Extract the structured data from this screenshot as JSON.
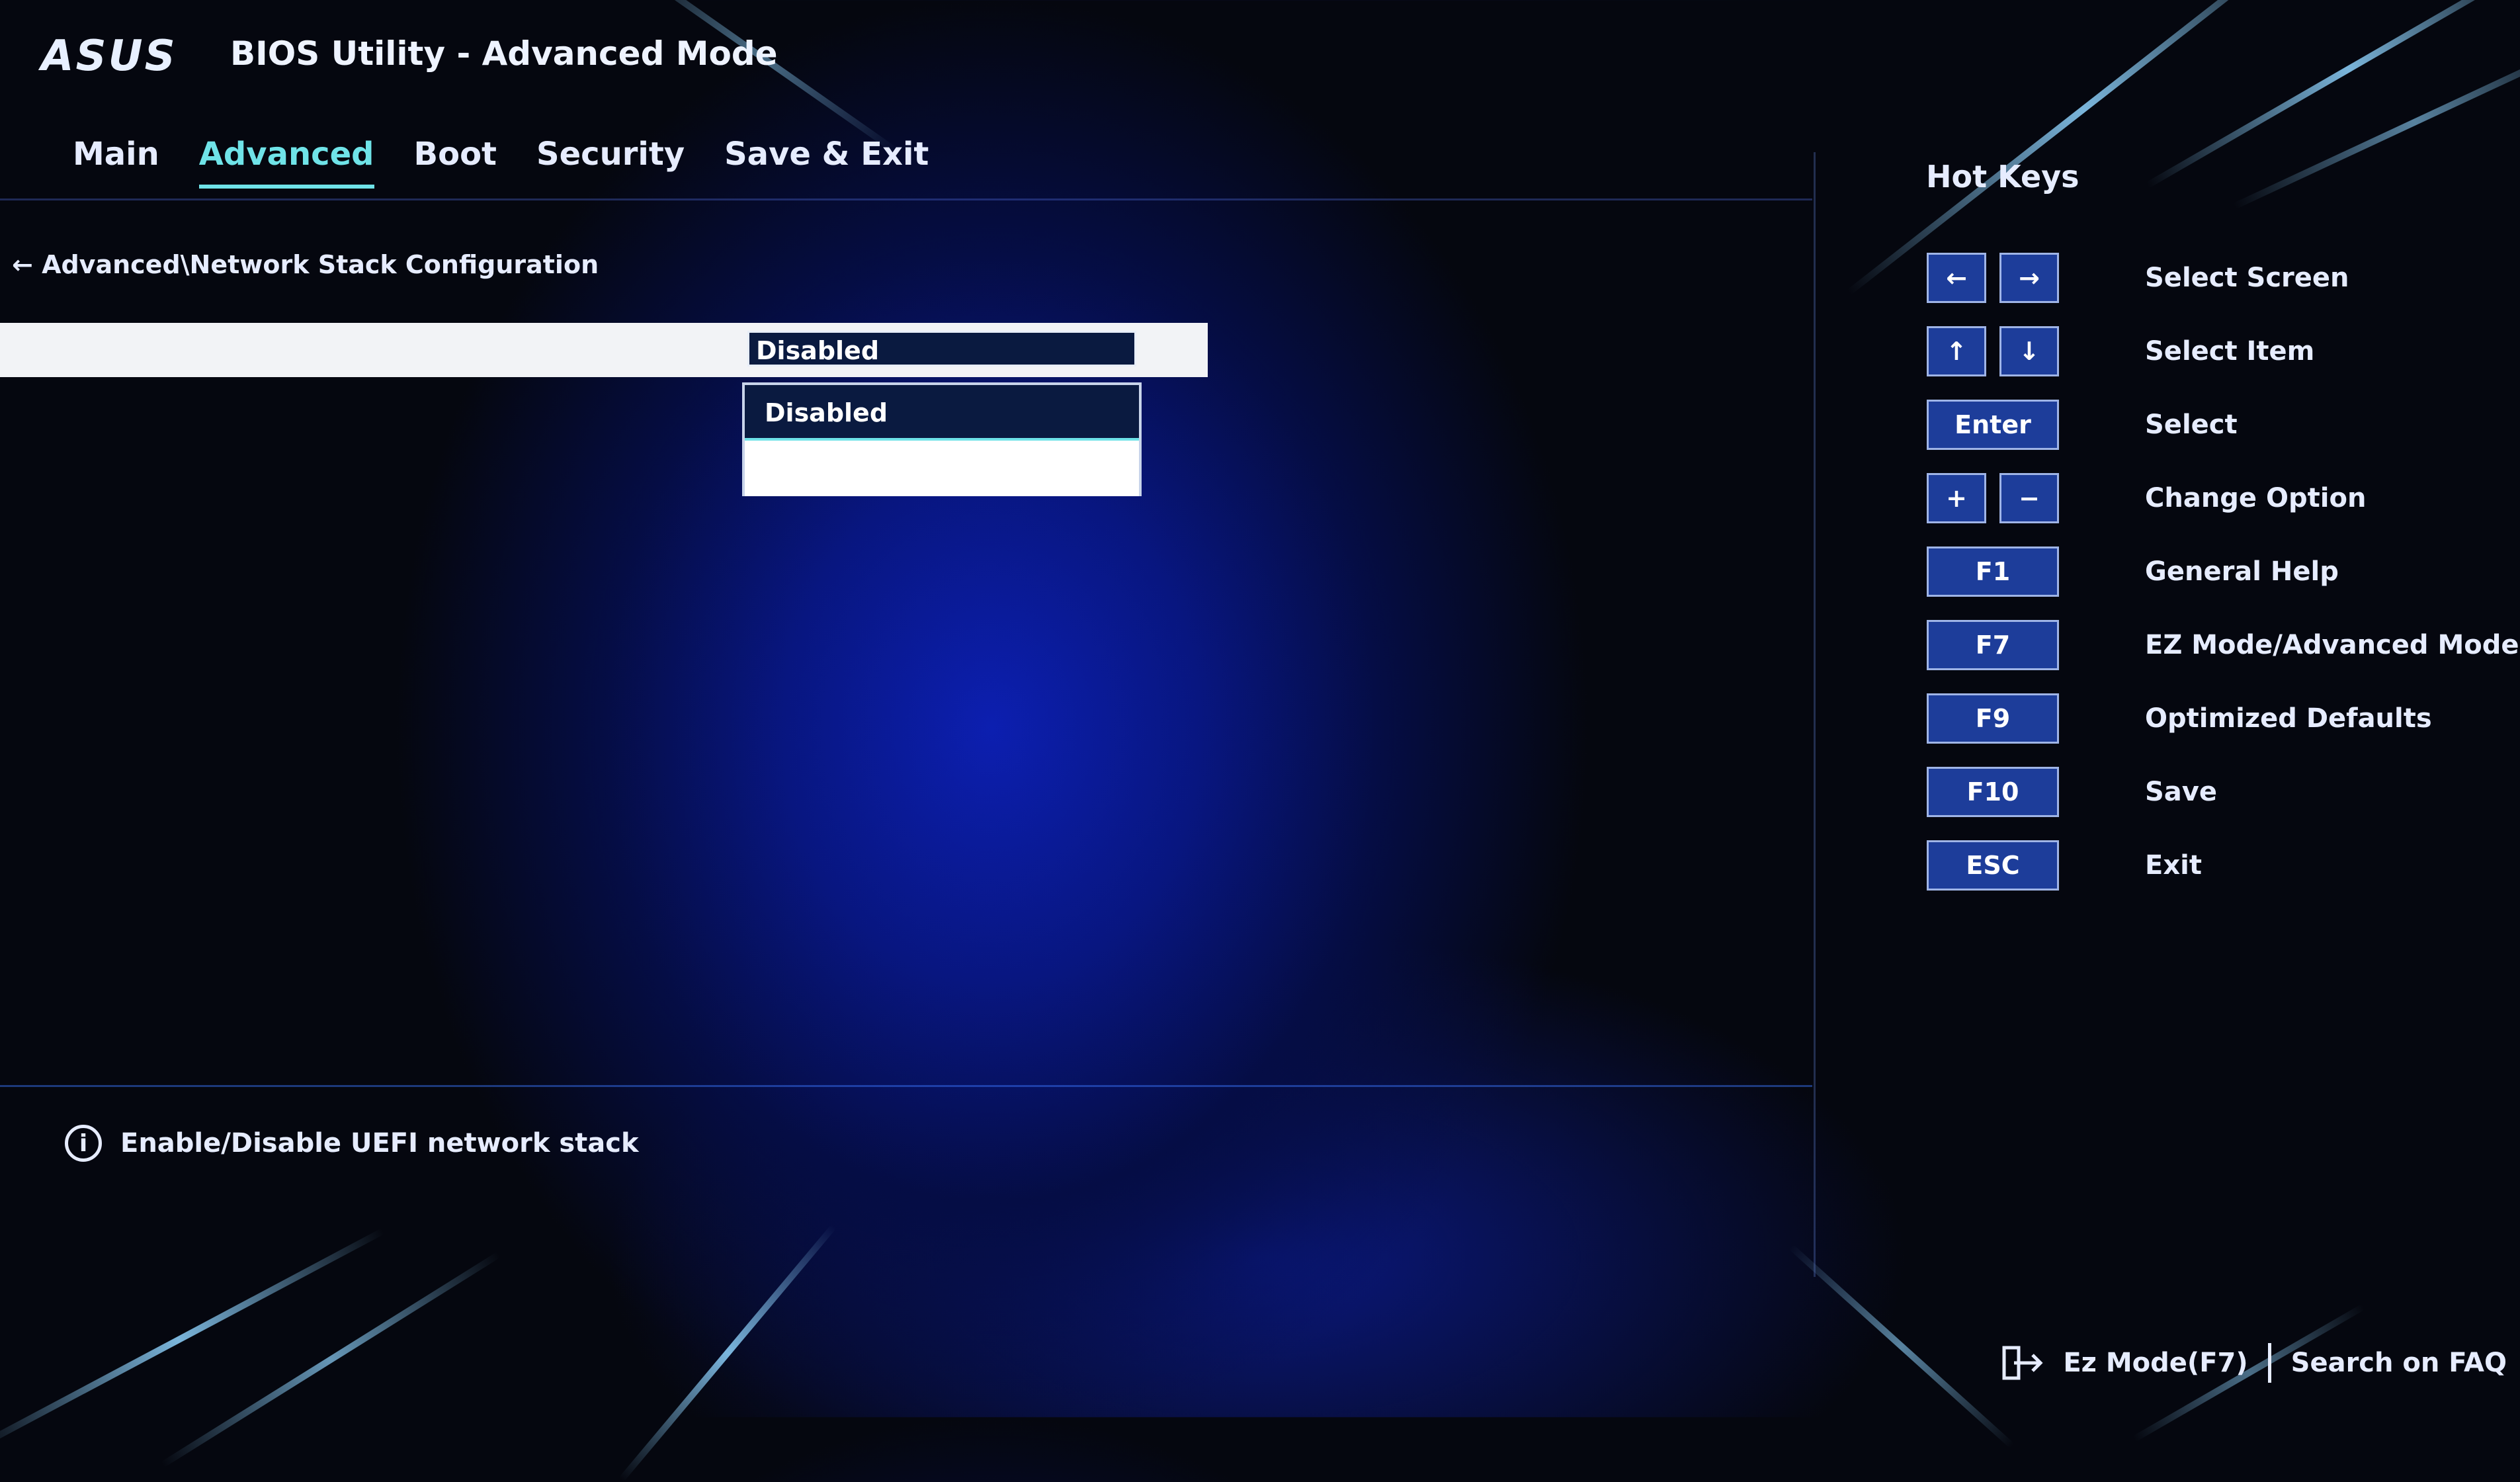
{
  "header": {
    "logo": "ASUS",
    "title": "BIOS Utility - Advanced Mode"
  },
  "tabs": [
    {
      "label": "Main"
    },
    {
      "label": "Advanced"
    },
    {
      "label": "Boot"
    },
    {
      "label": "Security"
    },
    {
      "label": "Save & Exit"
    }
  ],
  "breadcrumb": "← Advanced\\Network Stack Configuration",
  "setting": {
    "selected_value": "Disabled",
    "options": [
      "Disabled",
      ""
    ]
  },
  "help": {
    "icon": "info-icon",
    "text": "Enable/Disable UEFI network stack"
  },
  "hotkeys": {
    "title": "Hot Keys",
    "items": [
      {
        "keys": [
          "←",
          "→"
        ],
        "label": "Select Screen"
      },
      {
        "keys": [
          "↑",
          "↓"
        ],
        "label": "Select Item"
      },
      {
        "keys": [
          "Enter"
        ],
        "label": "Select"
      },
      {
        "keys": [
          "+",
          "−"
        ],
        "label": "Change Option"
      },
      {
        "keys": [
          "F1"
        ],
        "label": "General Help"
      },
      {
        "keys": [
          "F7"
        ],
        "label": "EZ Mode/Advanced Mode"
      },
      {
        "keys": [
          "F9"
        ],
        "label": "Optimized Defaults"
      },
      {
        "keys": [
          "F10"
        ],
        "label": "Save"
      },
      {
        "keys": [
          "ESC"
        ],
        "label": "Exit"
      }
    ]
  },
  "bottom_bar": {
    "ez_mode": "Ez Mode(F7)",
    "search": "Search on FAQ"
  },
  "colors": {
    "accent": "#6fe3e8",
    "key_bg": "#1d3d9a",
    "selected_bg": "#0a1a40"
  }
}
